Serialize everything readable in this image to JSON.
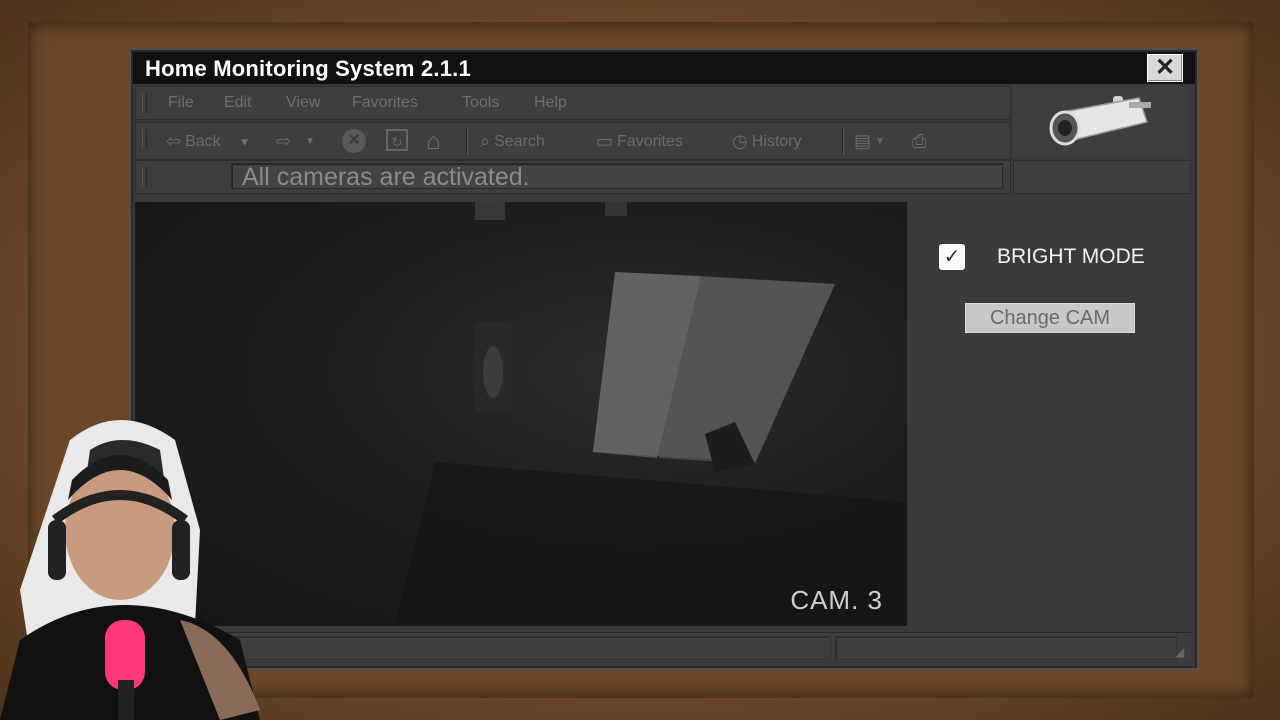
{
  "window": {
    "title": "Home Monitoring System 2.1.1",
    "close_label": "✕"
  },
  "menubar": {
    "items": [
      "File",
      "Edit",
      "View",
      "Favorites",
      "Tools",
      "Help"
    ]
  },
  "toolbar": {
    "back_label": "Back",
    "search_label": "Search",
    "favorites_label": "Favorites",
    "history_label": "History"
  },
  "address": {
    "value": "All cameras are activated."
  },
  "camera": {
    "label": "CAM. 3"
  },
  "side_panel": {
    "bright_mode_label": "BRIGHT MODE",
    "bright_mode_checked": true,
    "change_cam_label": "Change CAM"
  },
  "icons": {
    "logo": "security-camera-icon",
    "back": "back-arrow-icon",
    "forward": "forward-arrow-icon",
    "stop": "stop-icon",
    "refresh": "refresh-icon",
    "home": "home-icon",
    "search": "search-icon",
    "favorites": "favorites-folder-icon",
    "history": "history-icon",
    "mail": "mail-icon",
    "print": "print-icon"
  },
  "colors": {
    "title_bar": "#111111",
    "window_bg": "#3a3a3a",
    "button_bg": "#c8c8c8",
    "frame": "#6b4727"
  }
}
